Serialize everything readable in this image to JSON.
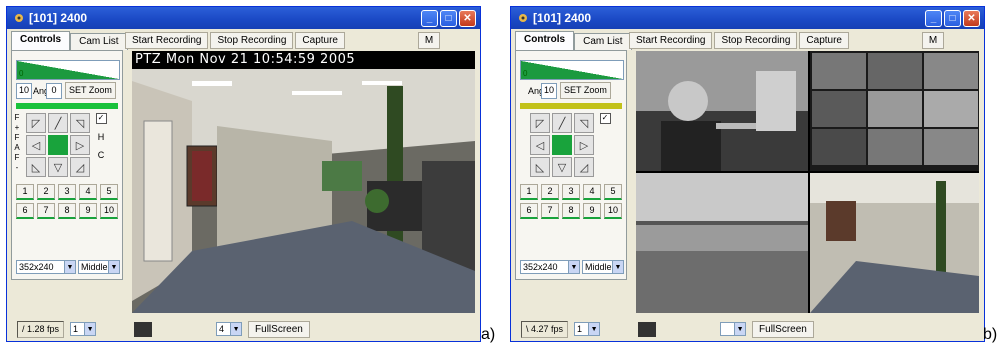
{
  "windowA": {
    "title": "[101] 2400",
    "tabs": [
      "Controls",
      "Cam List"
    ],
    "toolbar": [
      "Start Recording",
      "Stop Recording",
      "Capture"
    ],
    "m_label": "M",
    "zoom": {
      "min": "0",
      "max": "100",
      "level": 1.0
    },
    "angle": {
      "value1": "10",
      "label": "Angle",
      "value2": "0"
    },
    "set_zoom": "SET Zoom",
    "color_bar": "#19c23c",
    "side_left": [
      "F",
      "+",
      "F",
      "A",
      "F",
      "-"
    ],
    "side_right": {
      "h": "H",
      "c": "C"
    },
    "presets": [
      "1",
      "2",
      "3",
      "4",
      "5",
      "6",
      "7",
      "8",
      "9",
      "10"
    ],
    "resolution": "352x240",
    "quality": "Middle",
    "overlay": "PTZ  Mon Nov 21  10:54:59  2005",
    "fps": "/ 1.28 fps",
    "stream": "1",
    "channel": "4",
    "fullscreen": "FullScreen",
    "caption": "a)"
  },
  "windowB": {
    "title": "[101] 2400",
    "tabs": [
      "Controls",
      "Cam List"
    ],
    "toolbar": [
      "Start Recording",
      "Stop Recording",
      "Capture"
    ],
    "m_label": "M",
    "zoom": {
      "min": "0",
      "max": "100",
      "level": 1.0
    },
    "angle": {
      "value1": "10",
      "label": "Angle",
      "value2": ""
    },
    "set_zoom": "SET Zoom",
    "color_bar": "#c2c21a",
    "presets": [
      "1",
      "2",
      "3",
      "4",
      "5",
      "6",
      "7",
      "8",
      "9",
      "10"
    ],
    "resolution": "352x240",
    "quality": "Middle",
    "fps": "\\ 4.27 fps",
    "stream": "1",
    "channel": "",
    "fullscreen": "FullScreen",
    "caption": "b)"
  },
  "colors": {
    "accent": "#19a33c",
    "titlebar": "#1a48c4"
  }
}
